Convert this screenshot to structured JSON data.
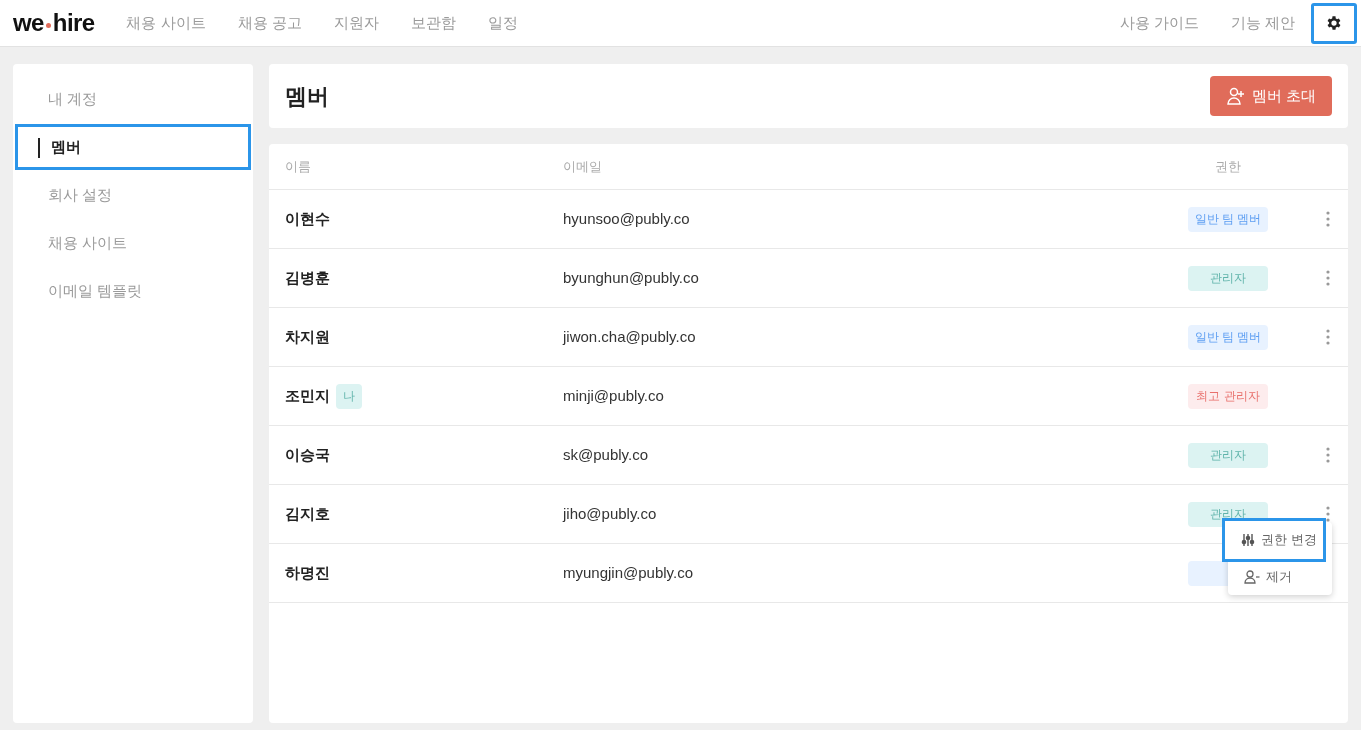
{
  "topbar": {
    "logo": {
      "left": "we",
      "right": "hire"
    },
    "nav": [
      {
        "label": "채용 사이트"
      },
      {
        "label": "채용 공고"
      },
      {
        "label": "지원자"
      },
      {
        "label": "보관함"
      },
      {
        "label": "일정"
      }
    ],
    "links": [
      {
        "label": "사용 가이드"
      },
      {
        "label": "기능 제안"
      }
    ],
    "settings_highlighted": true
  },
  "sidebar": {
    "items": [
      {
        "label": "내 계정",
        "selected": false,
        "highlighted": false
      },
      {
        "label": "멤버",
        "selected": true,
        "highlighted": true
      },
      {
        "label": "회사 설정",
        "selected": false,
        "highlighted": false
      },
      {
        "label": "채용 사이트",
        "selected": false,
        "highlighted": false
      },
      {
        "label": "이메일 템플릿",
        "selected": false,
        "highlighted": false
      }
    ]
  },
  "header": {
    "title": "멤버",
    "invite_button": "멤버 초대"
  },
  "table": {
    "columns": [
      "이름",
      "이메일",
      "권한"
    ],
    "rows": [
      {
        "name": "이현수",
        "email": "hyunsoo@publy.co",
        "role": "일반 팀 멤버",
        "kind": "member",
        "has_menu": true
      },
      {
        "name": "김병훈",
        "email": "byunghun@publy.co",
        "role": "관리자",
        "kind": "admin",
        "has_menu": true
      },
      {
        "name": "차지원",
        "email": "jiwon.cha@publy.co",
        "role": "일반 팀 멤버",
        "kind": "member",
        "has_menu": true
      },
      {
        "name": "조민지",
        "me_badge": "나",
        "email": "minji@publy.co",
        "role": "최고 관리자",
        "kind": "owner",
        "has_menu": false
      },
      {
        "name": "이승국",
        "email": "sk@publy.co",
        "role": "관리자",
        "kind": "admin",
        "has_menu": true
      },
      {
        "name": "김지호",
        "email": "jiho@publy.co",
        "role": "관리자",
        "kind": "admin",
        "has_menu": true,
        "menu_open": true
      },
      {
        "name": "하명진",
        "email": "myungjin@publy.co",
        "kind": "member",
        "has_menu": false
      }
    ]
  },
  "row_menu": {
    "items": [
      {
        "kind": "permission",
        "label": "권한 변경",
        "highlighted": true
      },
      {
        "kind": "remove",
        "label": "제거",
        "highlighted": false
      }
    ]
  }
}
